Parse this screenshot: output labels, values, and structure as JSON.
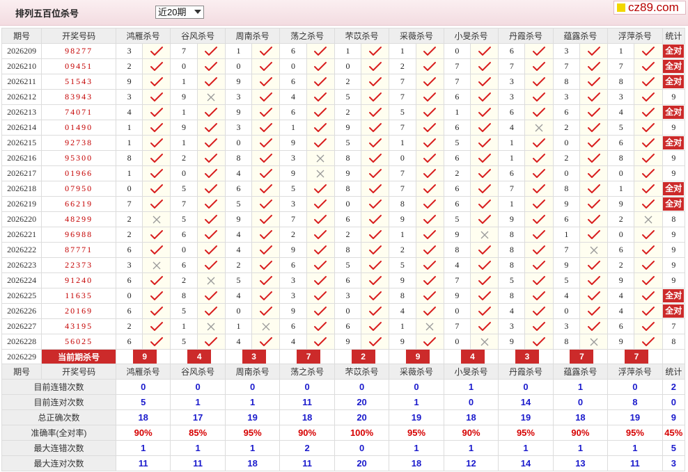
{
  "header": {
    "title": "排列五百位杀号",
    "range_select": "近20期",
    "logo_text": "cz89.com"
  },
  "columns": {
    "period": "期号",
    "numbers": "开奖号码",
    "experts": [
      "鸿雁杀号",
      "谷风杀号",
      "周南杀号",
      "荡之杀号",
      "芣苡杀号",
      "采薇杀号",
      "小旻杀号",
      "丹霞杀号",
      "蕴露杀号",
      "浮萍杀号"
    ],
    "stat": "统计"
  },
  "all_correct_label": "全对",
  "rows": [
    {
      "period": "2026209",
      "numbers": "98277",
      "kills": [
        "3",
        "7",
        "1",
        "6",
        "1",
        "1",
        "0",
        "6",
        "3",
        "1"
      ],
      "marks": [
        1,
        1,
        1,
        1,
        1,
        1,
        1,
        1,
        1,
        1
      ],
      "stat": "全对"
    },
    {
      "period": "2026210",
      "numbers": "09451",
      "kills": [
        "2",
        "0",
        "0",
        "0",
        "0",
        "2",
        "7",
        "7",
        "7",
        "7"
      ],
      "marks": [
        1,
        1,
        1,
        1,
        1,
        1,
        1,
        1,
        1,
        1
      ],
      "stat": "全对"
    },
    {
      "period": "2026211",
      "numbers": "51543",
      "kills": [
        "9",
        "1",
        "9",
        "6",
        "2",
        "7",
        "7",
        "3",
        "8",
        "8"
      ],
      "marks": [
        1,
        1,
        1,
        1,
        1,
        1,
        1,
        1,
        1,
        1
      ],
      "stat": "全对"
    },
    {
      "period": "2026212",
      "numbers": "83943",
      "kills": [
        "3",
        "9",
        "3",
        "4",
        "5",
        "7",
        "6",
        "3",
        "3",
        "3"
      ],
      "marks": [
        1,
        0,
        1,
        1,
        1,
        1,
        1,
        1,
        1,
        1
      ],
      "stat": "9"
    },
    {
      "period": "2026213",
      "numbers": "74071",
      "kills": [
        "4",
        "1",
        "9",
        "6",
        "2",
        "5",
        "1",
        "6",
        "6",
        "4"
      ],
      "marks": [
        1,
        1,
        1,
        1,
        1,
        1,
        1,
        1,
        1,
        1
      ],
      "stat": "全对"
    },
    {
      "period": "2026214",
      "numbers": "01490",
      "kills": [
        "1",
        "9",
        "3",
        "1",
        "9",
        "7",
        "6",
        "4",
        "2",
        "5"
      ],
      "marks": [
        1,
        1,
        1,
        1,
        1,
        1,
        1,
        0,
        1,
        1
      ],
      "stat": "9"
    },
    {
      "period": "2026215",
      "numbers": "92738",
      "kills": [
        "1",
        "1",
        "0",
        "9",
        "5",
        "1",
        "5",
        "1",
        "0",
        "6"
      ],
      "marks": [
        1,
        1,
        1,
        1,
        1,
        1,
        1,
        1,
        1,
        1
      ],
      "stat": "全对"
    },
    {
      "period": "2026216",
      "numbers": "95300",
      "kills": [
        "8",
        "2",
        "8",
        "3",
        "8",
        "0",
        "6",
        "1",
        "2",
        "8"
      ],
      "marks": [
        1,
        1,
        1,
        0,
        1,
        1,
        1,
        1,
        1,
        1
      ],
      "stat": "9"
    },
    {
      "period": "2026217",
      "numbers": "01966",
      "kills": [
        "1",
        "0",
        "4",
        "9",
        "9",
        "7",
        "2",
        "6",
        "0",
        "0"
      ],
      "marks": [
        1,
        1,
        1,
        0,
        1,
        1,
        1,
        1,
        1,
        1
      ],
      "stat": "9"
    },
    {
      "period": "2026218",
      "numbers": "07950",
      "kills": [
        "0",
        "5",
        "6",
        "5",
        "8",
        "7",
        "6",
        "7",
        "8",
        "1"
      ],
      "marks": [
        1,
        1,
        1,
        1,
        1,
        1,
        1,
        1,
        1,
        1
      ],
      "stat": "全对"
    },
    {
      "period": "2026219",
      "numbers": "66219",
      "kills": [
        "7",
        "7",
        "5",
        "3",
        "0",
        "8",
        "6",
        "1",
        "9",
        "9"
      ],
      "marks": [
        1,
        1,
        1,
        1,
        1,
        1,
        1,
        1,
        1,
        1
      ],
      "stat": "全对"
    },
    {
      "period": "2026220",
      "numbers": "48299",
      "kills": [
        "2",
        "5",
        "9",
        "7",
        "6",
        "9",
        "5",
        "9",
        "6",
        "2"
      ],
      "marks": [
        0,
        1,
        1,
        1,
        1,
        1,
        1,
        1,
        1,
        0
      ],
      "stat": "8"
    },
    {
      "period": "2026221",
      "numbers": "96988",
      "kills": [
        "2",
        "6",
        "4",
        "2",
        "2",
        "1",
        "9",
        "8",
        "1",
        "0"
      ],
      "marks": [
        1,
        1,
        1,
        1,
        1,
        1,
        0,
        1,
        1,
        1
      ],
      "stat": "9"
    },
    {
      "period": "2026222",
      "numbers": "87771",
      "kills": [
        "6",
        "0",
        "4",
        "9",
        "8",
        "2",
        "8",
        "8",
        "7",
        "6"
      ],
      "marks": [
        1,
        1,
        1,
        1,
        1,
        1,
        1,
        1,
        0,
        1
      ],
      "stat": "9"
    },
    {
      "period": "2026223",
      "numbers": "22373",
      "kills": [
        "3",
        "6",
        "2",
        "6",
        "5",
        "5",
        "4",
        "8",
        "9",
        "2"
      ],
      "marks": [
        0,
        1,
        1,
        1,
        1,
        1,
        1,
        1,
        1,
        1
      ],
      "stat": "9"
    },
    {
      "period": "2026224",
      "numbers": "91240",
      "kills": [
        "6",
        "2",
        "5",
        "3",
        "6",
        "9",
        "7",
        "5",
        "5",
        "9"
      ],
      "marks": [
        1,
        0,
        1,
        1,
        1,
        1,
        1,
        1,
        1,
        1
      ],
      "stat": "9"
    },
    {
      "period": "2026225",
      "numbers": "11635",
      "kills": [
        "0",
        "8",
        "4",
        "3",
        "3",
        "8",
        "9",
        "8",
        "4",
        "4"
      ],
      "marks": [
        1,
        1,
        1,
        1,
        1,
        1,
        1,
        1,
        1,
        1
      ],
      "stat": "全对"
    },
    {
      "period": "2026226",
      "numbers": "20169",
      "kills": [
        "6",
        "5",
        "0",
        "9",
        "0",
        "4",
        "0",
        "4",
        "0",
        "4"
      ],
      "marks": [
        1,
        1,
        1,
        1,
        1,
        1,
        1,
        1,
        1,
        1
      ],
      "stat": "全对"
    },
    {
      "period": "2026227",
      "numbers": "43195",
      "kills": [
        "2",
        "1",
        "1",
        "6",
        "6",
        "1",
        "7",
        "3",
        "3",
        "6"
      ],
      "marks": [
        1,
        0,
        0,
        1,
        1,
        0,
        1,
        1,
        1,
        1
      ],
      "stat": "7"
    },
    {
      "period": "2026228",
      "numbers": "56025",
      "kills": [
        "6",
        "5",
        "4",
        "4",
        "9",
        "9",
        "0",
        "9",
        "8",
        "9"
      ],
      "marks": [
        1,
        1,
        1,
        1,
        1,
        1,
        0,
        1,
        0,
        1
      ],
      "stat": "8"
    }
  ],
  "current": {
    "period": "2026229",
    "label": "当前期杀号",
    "kills": [
      "9",
      "4",
      "3",
      "7",
      "2",
      "9",
      "4",
      "3",
      "7",
      "7"
    ]
  },
  "summary_rows": [
    {
      "label": "目前连错次数",
      "values": [
        "0",
        "0",
        "0",
        "0",
        "0",
        "0",
        "1",
        "0",
        "1",
        "0"
      ],
      "stat": "2"
    },
    {
      "label": "目前连对次数",
      "values": [
        "5",
        "1",
        "1",
        "11",
        "20",
        "1",
        "0",
        "14",
        "0",
        "8"
      ],
      "stat": "0"
    },
    {
      "label": "总正确次数",
      "values": [
        "18",
        "17",
        "19",
        "18",
        "20",
        "19",
        "18",
        "19",
        "18",
        "19"
      ],
      "stat": "9"
    },
    {
      "label": "准确率(全对率)",
      "values": [
        "90%",
        "85%",
        "95%",
        "90%",
        "100%",
        "95%",
        "90%",
        "95%",
        "90%",
        "95%"
      ],
      "stat": "45%",
      "red": true
    },
    {
      "label": "最大连错次数",
      "values": [
        "1",
        "1",
        "1",
        "2",
        "0",
        "1",
        "1",
        "1",
        "1",
        "1"
      ],
      "stat": "5"
    },
    {
      "label": "最大连对次数",
      "values": [
        "11",
        "11",
        "18",
        "11",
        "20",
        "18",
        "12",
        "14",
        "13",
        "11"
      ],
      "stat": "3"
    }
  ]
}
